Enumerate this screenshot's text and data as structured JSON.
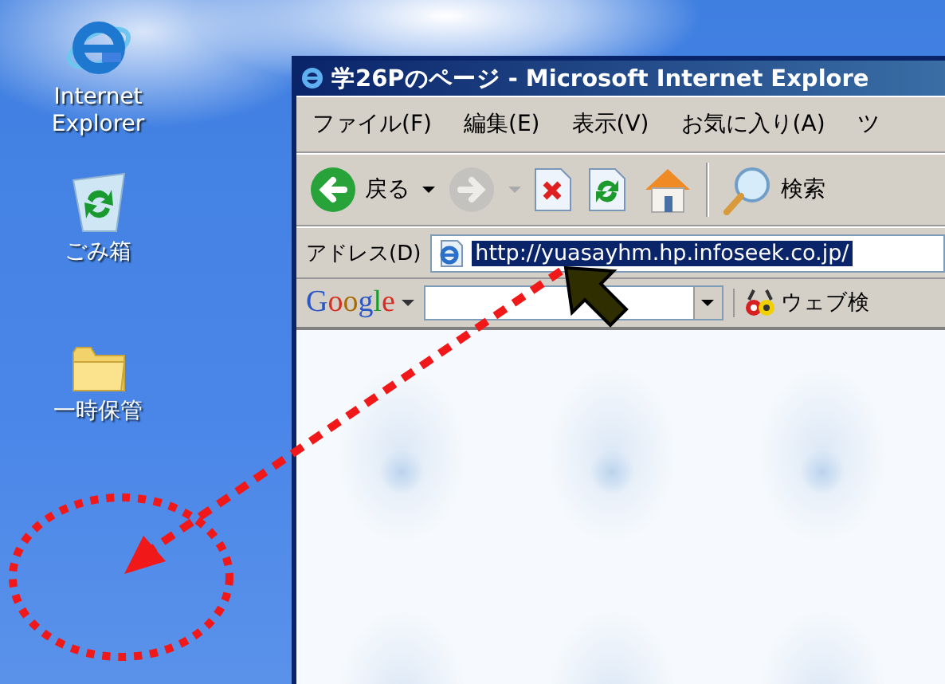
{
  "desktop_icons": [
    {
      "kind": "ie",
      "label": "Internet Explorer"
    },
    {
      "kind": "recycle",
      "label": "ごみ箱"
    },
    {
      "kind": "folder",
      "label": "一時保管"
    }
  ],
  "window": {
    "title": "学26Pのページ - Microsoft Internet Explore",
    "menu": [
      "ファイル(F)",
      "編集(E)",
      "表示(V)",
      "お気に入り(A)",
      "ツ"
    ],
    "toolbar": [
      {
        "kind": "back",
        "label": "戻る",
        "disabled": false
      },
      {
        "kind": "forward",
        "disabled": true
      },
      {
        "kind": "stop",
        "disabled": false
      },
      {
        "kind": "refresh",
        "disabled": false
      },
      {
        "kind": "home",
        "disabled": false
      },
      {
        "kind": "search",
        "label": "検索",
        "disabled": false
      }
    ],
    "address": {
      "label": "アドレス(D)",
      "value": "http://yuasayhm.hp.infoseek.co.jp/",
      "selected": true
    },
    "google_bar": {
      "logo": "Google",
      "button": "ウェブ検"
    }
  }
}
